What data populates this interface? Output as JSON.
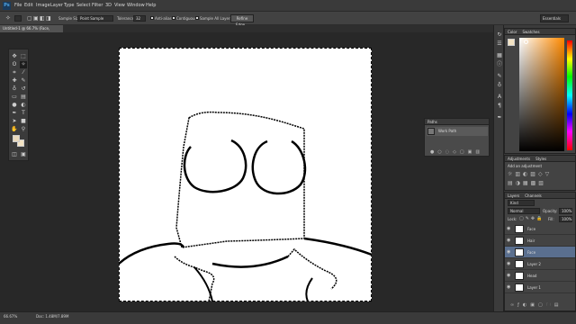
{
  "app": {
    "logo": "Ps"
  },
  "menu": [
    "File",
    "Edit",
    "Image",
    "Layer",
    "Type",
    "Select",
    "Filter",
    "3D",
    "View",
    "Window",
    "Help"
  ],
  "options": {
    "sample_size_label": "Sample Size:",
    "sample_size_value": "Point Sample",
    "tolerance_label": "Tolerance:",
    "tolerance_value": "32",
    "anti_alias": "Anti-alias",
    "contiguous": "Contiguous",
    "sample_all_layers": "Sample All Layers",
    "refine_edge": "Refine Edge...",
    "workspace": "Essentials"
  },
  "document": {
    "tab_label": "Untitled-1 @ 66.7% (Face, RGB/8) *"
  },
  "status": {
    "zoom": "66.67%",
    "doc": "Doc: 1.48M/7.89M"
  },
  "paths_panel": {
    "title": "Paths",
    "work_path": "Work Path"
  },
  "color_panel": {
    "tab_color": "Color",
    "tab_swatches": "Swatches"
  },
  "adjustments_panel": {
    "tab_adjustments": "Adjustments",
    "tab_styles": "Styles",
    "add_label": "Add an adjustment"
  },
  "layers_panel": {
    "tab_layers": "Layers",
    "tab_channels": "Channels",
    "kind": "Kind",
    "blend": "Normal",
    "opacity_label": "Opacity:",
    "opacity_value": "100%",
    "lock_label": "Lock:",
    "fill_label": "Fill:",
    "fill_value": "100%",
    "layers": [
      {
        "name": "Face",
        "selected": false
      },
      {
        "name": "Hair",
        "selected": false
      },
      {
        "name": "Face",
        "selected": true
      },
      {
        "name": "Layer 2",
        "selected": false
      },
      {
        "name": "Head",
        "selected": false
      },
      {
        "name": "Layer 1",
        "selected": false
      }
    ]
  },
  "colors": {
    "foreground": "#e9d9bc",
    "background": "#f3e3c3",
    "selection": "#5a6f8f"
  }
}
